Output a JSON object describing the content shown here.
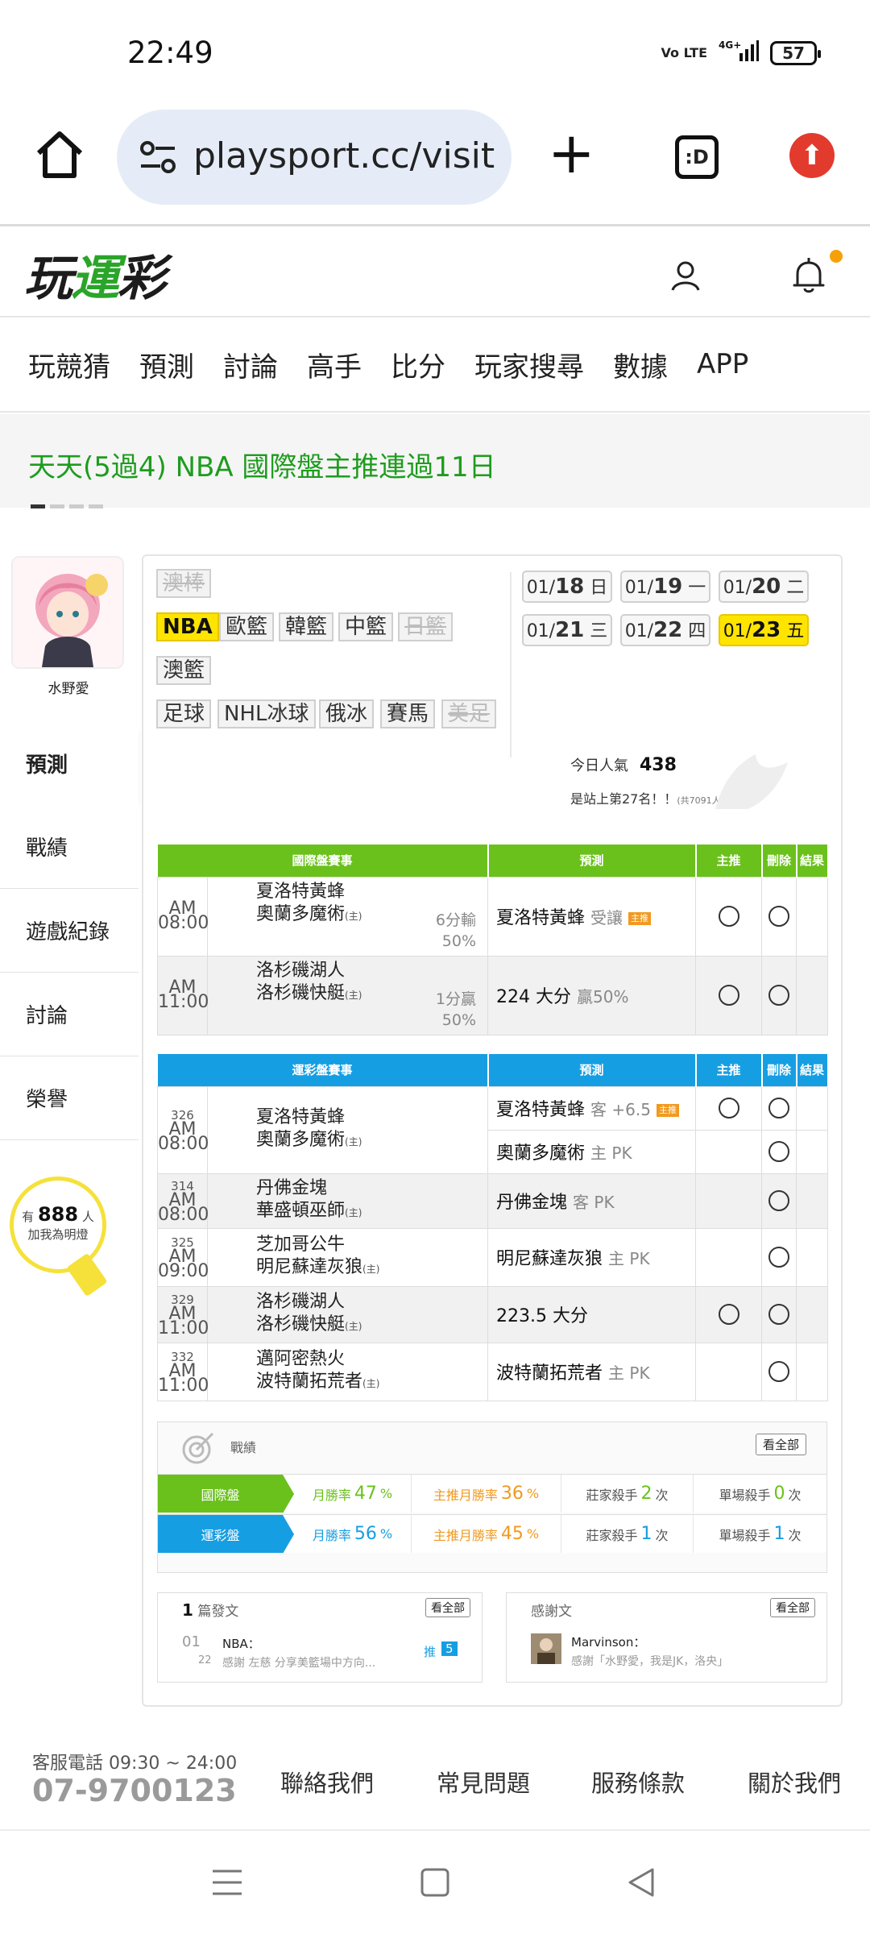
{
  "status_bar": {
    "time": "22:49",
    "network": "4G+",
    "volte": "Vo LTE",
    "battery": "57"
  },
  "browser": {
    "url": "playsport.cc/visit",
    "tabs_label": ":D"
  },
  "site": {
    "logo_a": "玩",
    "logo_b": "運",
    "logo_c": "彩"
  },
  "nav": [
    "玩競猜",
    "預測",
    "討論",
    "高手",
    "比分",
    "玩家搜尋",
    "數據",
    "APP"
  ],
  "banner": {
    "text": "天天(5過4) NBA 國際盤主推連過11日"
  },
  "profile": {
    "name": "水野愛",
    "fans_prefix": "有",
    "fans_count": "888",
    "fans_unit": "人",
    "fans_cta": "加我為明燈"
  },
  "left_nav": [
    "預測",
    "戰績",
    "遊戲紀錄",
    "討論",
    "榮譽"
  ],
  "sports": {
    "tags": [
      {
        "label": "澳棒",
        "state": "dim"
      },
      {
        "label": "NBA",
        "state": "selected"
      },
      {
        "label": "歐籃",
        "state": "normal"
      },
      {
        "label": "韓籃",
        "state": "normal"
      },
      {
        "label": "中籃",
        "state": "normal"
      },
      {
        "label": "日籃",
        "state": "dim"
      },
      {
        "label": "澳籃",
        "state": "normal"
      },
      {
        "label": "足球",
        "state": "normal"
      },
      {
        "label": "NHL冰球",
        "state": "normal"
      },
      {
        "label": "俄冰",
        "state": "normal"
      },
      {
        "label": "賽馬",
        "state": "normal"
      },
      {
        "label": "美足",
        "state": "dim"
      }
    ]
  },
  "dates": [
    {
      "md": "01/",
      "d": "18",
      "w": "日"
    },
    {
      "md": "01/",
      "d": "19",
      "w": "一"
    },
    {
      "md": "01/",
      "d": "20",
      "w": "二"
    },
    {
      "md": "01/",
      "d": "21",
      "w": "三"
    },
    {
      "md": "01/",
      "d": "22",
      "w": "四"
    },
    {
      "md": "01/",
      "d": "23",
      "w": "五",
      "selected": true
    }
  ],
  "popularity": {
    "label": "今日人氣",
    "value": "438",
    "rank": "是站上第27名！！",
    "rank_note": "(共7091人)"
  },
  "intl_table": {
    "headers": [
      "國際盤賽事",
      "預測",
      "主推",
      "刪除",
      "結果"
    ],
    "rows": [
      {
        "time": "AM 08:00",
        "team1": "夏洛特黃蜂",
        "team2": "奧蘭多魔術",
        "home": "(主)",
        "odds1": "6分輸",
        "odds2": "50%",
        "pick": "夏洛特黃蜂",
        "pick_note": "受讓",
        "badge": "主推"
      },
      {
        "time": "AM 11:00",
        "team1": "洛杉磯湖人",
        "team2": "洛杉磯快艇",
        "home": "(主)",
        "odds1": "1分贏",
        "odds2": "50%",
        "pick": "224 大分",
        "pick_note": "贏50%",
        "badge": ""
      }
    ]
  },
  "local_table": {
    "headers": [
      "運彩盤賽事",
      "預測",
      "主推",
      "刪除",
      "結果"
    ],
    "rows": [
      {
        "no": "326",
        "time": "AM 08:00",
        "team1": "夏洛特黃蜂",
        "team2": "奧蘭多魔術",
        "home": "(主)",
        "picks": [
          {
            "pick": "夏洛特黃蜂",
            "note": "客 +6.5",
            "badge": "主推",
            "main": true
          },
          {
            "pick": "奧蘭多魔術",
            "note": "主 PK",
            "badge": "",
            "main": false
          }
        ]
      },
      {
        "no": "314",
        "time": "AM 08:00",
        "team1": "丹佛金塊",
        "team2": "華盛頓巫師",
        "home": "(主)",
        "picks": [
          {
            "pick": "丹佛金塊",
            "note": "客 PK",
            "badge": "",
            "main": false
          }
        ]
      },
      {
        "no": "325",
        "time": "AM 09:00",
        "team1": "芝加哥公牛",
        "team2": "明尼蘇達灰狼",
        "home": "(主)",
        "picks": [
          {
            "pick": "明尼蘇達灰狼",
            "note": "主 PK",
            "badge": "",
            "main": false
          }
        ]
      },
      {
        "no": "329",
        "time": "AM 11:00",
        "team1": "洛杉磯湖人",
        "team2": "洛杉磯快艇",
        "home": "(主)",
        "picks": [
          {
            "pick": "223.5 大分",
            "note": "",
            "badge": "",
            "main": true
          }
        ]
      },
      {
        "no": "332",
        "time": "AM 11:00",
        "team1": "邁阿密熱火",
        "team2": "波特蘭拓荒者",
        "home": "(主)",
        "picks": [
          {
            "pick": "波特蘭拓荒者",
            "note": "主 PK",
            "badge": "",
            "main": false
          }
        ]
      }
    ]
  },
  "stats": {
    "title": "戰績",
    "all": "看全部",
    "rows": [
      {
        "label": "國際盤",
        "color": "#6ac11b",
        "m_label": "月勝率",
        "m_val": "47",
        "mm_label": "主推月勝率",
        "mm_val": "36",
        "pct": "%",
        "k_label": "莊家殺手",
        "k_val": "2",
        "s_label": "單場殺手",
        "s_val": "0",
        "unit": "次"
      },
      {
        "label": "運彩盤",
        "color": "#169ee3",
        "m_label": "月勝率",
        "m_val": "56",
        "mm_label": "主推月勝率",
        "mm_val": "45",
        "pct": "%",
        "k_label": "莊家殺手",
        "k_val": "1",
        "s_label": "單場殺手",
        "s_val": "1",
        "unit": "次"
      }
    ]
  },
  "posts": {
    "count": "1",
    "label": "篇發文",
    "all": "看全部",
    "no": "01",
    "date": "22",
    "cat": "NBA：",
    "text": "感謝 左慈 分享美籃場中方向...",
    "push": "推",
    "push_n": "5"
  },
  "thanks": {
    "label": "感謝文",
    "all": "看全部",
    "user": "Marvinson：",
    "text": "感謝「水野愛，我是JK，洛央」"
  },
  "footer": {
    "phone_label": "客服電話 09:30 ~ 24:00",
    "phone": "07-9700123",
    "links": [
      "聯絡我們",
      "常見問題",
      "服務條款",
      "關於我們"
    ]
  }
}
